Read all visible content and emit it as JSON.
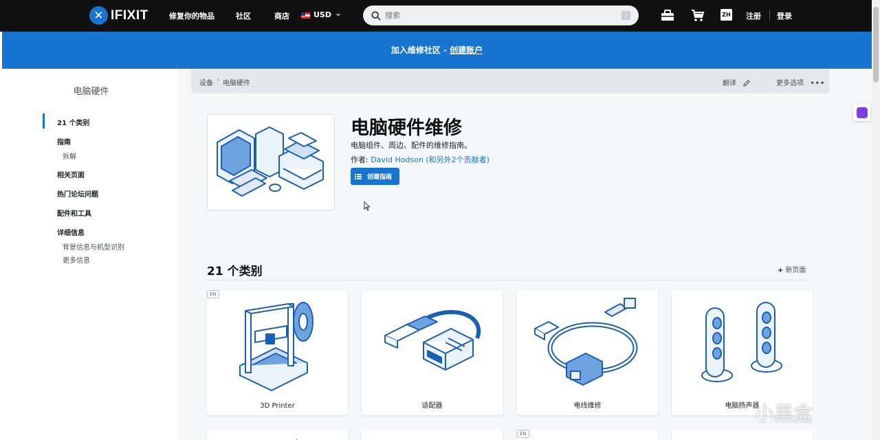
{
  "nav": {
    "logo_text": "IFIXIT",
    "links": [
      "修复你的物品",
      "社区",
      "商店"
    ],
    "currency": "USD",
    "search_placeholder": "搜索",
    "lang": "ZH",
    "signup": "注册",
    "login": "登录"
  },
  "banner": {
    "text": "加入维修社区 - ",
    "link": "创建账户"
  },
  "sidebar": {
    "title": "电脑硬件",
    "items": [
      {
        "label": "21 个类别",
        "active": true
      },
      {
        "label": "指南"
      },
      {
        "label": "拆解",
        "sub": true
      },
      {
        "label": "相关页面"
      },
      {
        "label": "热门论坛问题"
      },
      {
        "label": "配件和工具"
      },
      {
        "label": "详细信息"
      },
      {
        "label": "背景信息与机型识别",
        "sub": true
      },
      {
        "label": "更多信息",
        "sub": true
      }
    ]
  },
  "breadcrumb": {
    "items": [
      "设备",
      "电脑硬件"
    ],
    "translate": "翻译",
    "more_options": "更多选项"
  },
  "page": {
    "title": "电脑硬件维修",
    "description": "电脑组件、周边、配件的维修指南。",
    "author_prefix": "作者: ",
    "author_link": "David Hodson (和另外2个贡献者)",
    "create_guide": "创建指南"
  },
  "categories": {
    "heading": "21 个类别",
    "new_page": "新页面",
    "cards": [
      {
        "label": "3D Printer",
        "badge": "EN"
      },
      {
        "label": "适配器"
      },
      {
        "label": "电线维修"
      },
      {
        "label": "电脑扬声器"
      }
    ],
    "next_row_badge": "EN"
  },
  "watermark": "小黑盒",
  "colors": {
    "brand_blue": "#1775d1",
    "topbar": "#111111",
    "main_bg": "#f5f6f7"
  }
}
